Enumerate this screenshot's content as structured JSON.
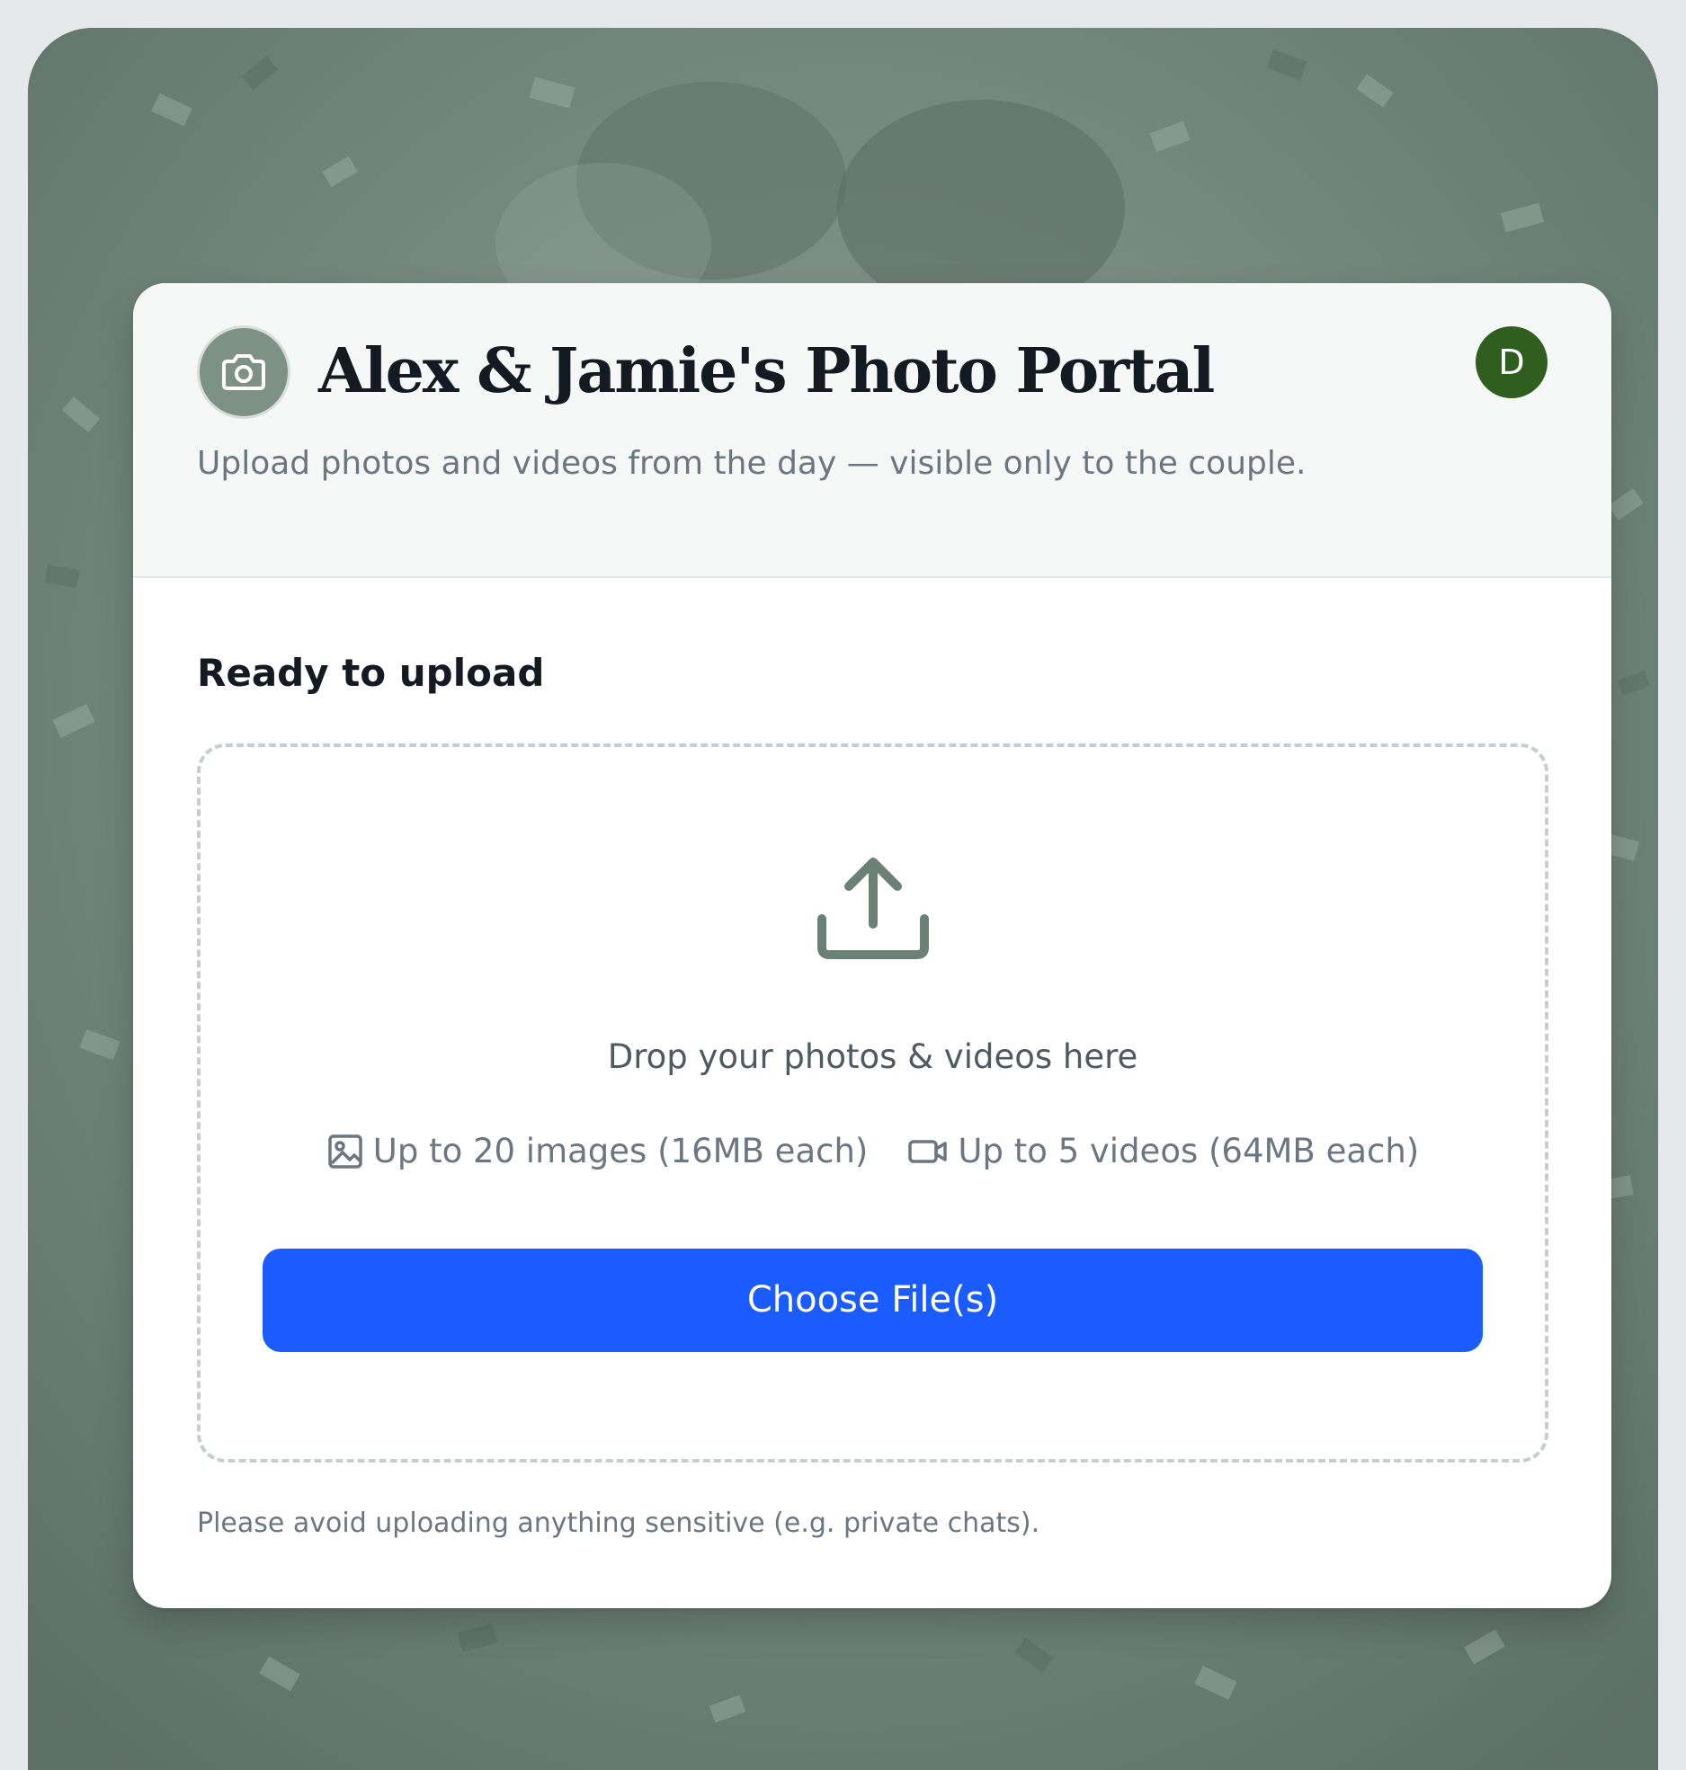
{
  "header": {
    "title": "Alex & Jamie's Photo Portal",
    "subtitle": "Upload photos and videos from the day — visible only to the couple.",
    "logo_icon": "camera-icon",
    "avatar_initial": "D"
  },
  "upload": {
    "section_title": "Ready to upload",
    "upload_icon": "upload-icon",
    "drop_text": "Drop your photos & videos here",
    "image_limit": "Up to 20 images (16MB each)",
    "image_limit_icon": "image-icon",
    "video_limit": "Up to 5 videos (64MB each)",
    "video_limit_icon": "video-icon",
    "choose_button_label": "Choose File(s)"
  },
  "footer_note": "Please avoid uploading anything sensitive (e.g. private chats).",
  "colors": {
    "page_background": "#e6e9ec",
    "backdrop_tint": "#6f8479",
    "logo_circle": "#7d9184",
    "avatar_background": "#2f5e1f",
    "primary_button": "#1a5cff",
    "title_text": "#141a22",
    "muted_text": "#6b7680"
  }
}
